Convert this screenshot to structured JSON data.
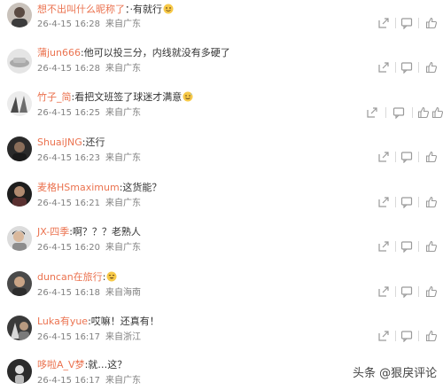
{
  "comments": [
    {
      "user": "想不出叫什么昵称了",
      "sep": "：",
      "text": "·有就行",
      "emoji": "smile-emoji",
      "date": "26-4-15 16:28",
      "source": "来自广东"
    },
    {
      "user": "蒲jun666",
      "sep": ":",
      "text": "他可以投三分，内线就没有多硬了",
      "emoji": "",
      "date": "26-4-15 16:28",
      "source": "来自广东"
    },
    {
      "user": "竹子_简",
      "sep": ":",
      "text": "看把文班签了球迷才满意",
      "emoji": "sweat-smile-emoji",
      "date": "26-4-15 16:25",
      "source": "来自广东"
    },
    {
      "user": "ShuaiJNG",
      "sep": ":",
      "text": "还行",
      "emoji": "",
      "date": "26-4-15 16:23",
      "source": "来自广东"
    },
    {
      "user": "麦格HSmaximum",
      "sep": ":",
      "text": "这货能？",
      "emoji": "",
      "date": "26-4-15 16:21",
      "source": "来自广东"
    },
    {
      "user": "JX-四季",
      "sep": ":",
      "text": "啊？？？老熟人",
      "emoji": "",
      "date": "26-4-15 16:20",
      "source": "来自广东"
    },
    {
      "user": "duncan在旅行",
      "sep": ":",
      "text": "",
      "emoji": "laugh-emoji",
      "date": "26-4-15 16:18",
      "source": "来自海南"
    },
    {
      "user": "Luka有yue",
      "sep": ":",
      "text": "哎嘛！还真有！",
      "emoji": "",
      "date": "26-4-15 16:17",
      "source": "来自浙江"
    },
    {
      "user": "哆啦A_V梦",
      "sep": ":",
      "text": "就…这？",
      "emoji": "",
      "date": "26-4-15 16:17",
      "source": "来自广东"
    }
  ],
  "icons": [
    "share-icon",
    "comment-icon",
    "like-icon"
  ],
  "colors": {
    "username": "#eb7350",
    "meta": "#808080",
    "icon": "#9a9a9a"
  },
  "watermark": {
    "brand": "头条",
    "handle": "@狠戾评论"
  }
}
